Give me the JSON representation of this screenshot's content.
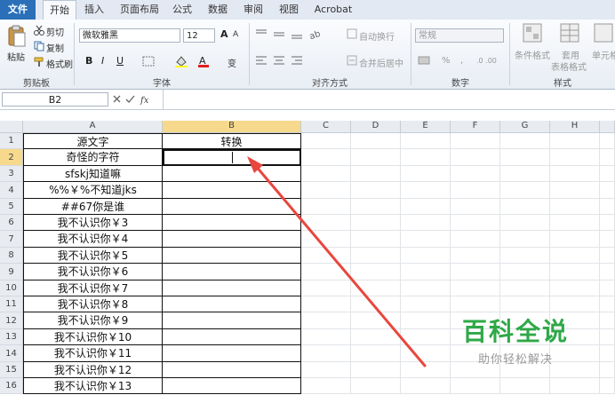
{
  "ribbon_tabs": [
    "文件",
    "开始",
    "插入",
    "页面布局",
    "公式",
    "数据",
    "审阅",
    "视图",
    "Acrobat"
  ],
  "active_tab": "开始",
  "clipboard": {
    "paste": "粘贴",
    "cut": "剪切",
    "copy": "复制",
    "format_painter": "格式刷",
    "group": "剪贴板"
  },
  "font": {
    "name": "微软雅黑",
    "size": "12",
    "bold": "B",
    "italic": "I",
    "underline": "U",
    "group": "字体",
    "grow": "A",
    "shrink": "A",
    "phonetic": "变"
  },
  "alignment": {
    "wrap": "自动换行",
    "merge": "合并后居中",
    "group": "对齐方式"
  },
  "number": {
    "format": "常规",
    "percent": "%",
    "comma": ",",
    "group": "数字"
  },
  "styles": {
    "conditional": "条件格式",
    "table": "套用",
    "table2": "表格格式",
    "cell": "单元格",
    "group": "样式"
  },
  "formula_bar": {
    "name_box": "B2",
    "fx": "fx"
  },
  "columns": [
    "A",
    "B",
    "C",
    "D",
    "E",
    "F",
    "G",
    "H"
  ],
  "rows": [
    "1",
    "2",
    "3",
    "4",
    "5",
    "6",
    "7",
    "8",
    "9",
    "10",
    "11",
    "12",
    "13",
    "14",
    "15",
    "16"
  ],
  "cells_a": [
    "源文字",
    "奇怪的字符",
    "sfskj知道嘛",
    "%%￥%不知道jks",
    "##67你是谁",
    "我不认识你￥3",
    "我不认识你￥4",
    "我不认识你￥5",
    "我不认识你￥6",
    "我不认识你￥7",
    "我不认识你￥8",
    "我不认识你￥9",
    "我不认识你￥10",
    "我不认识你￥11",
    "我不认识你￥12",
    "我不认识你￥13"
  ],
  "cell_b1": "转换",
  "watermark": {
    "title": "百科全说",
    "subtitle": "助你轻松解决"
  },
  "colors": {
    "file_tab": "#2a6fb8",
    "arrow": "#e8473e",
    "watermark": "#2fa848"
  }
}
